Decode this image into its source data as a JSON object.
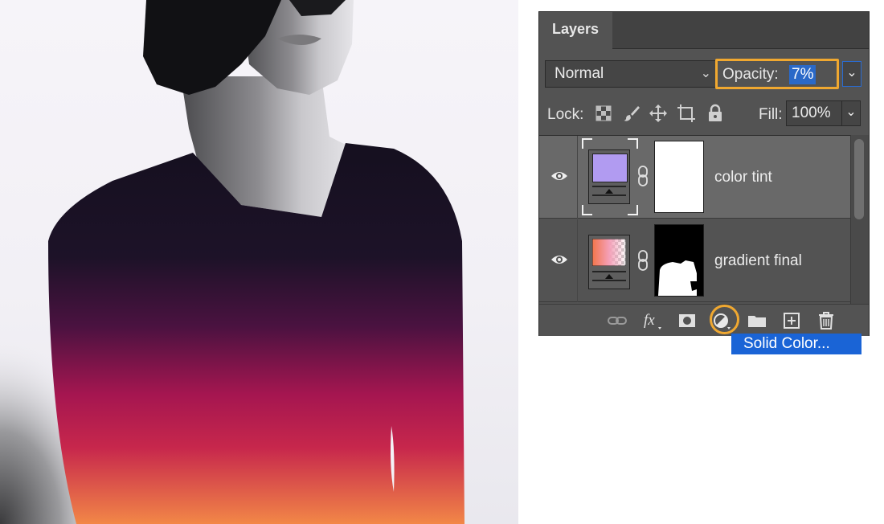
{
  "panel": {
    "tab_label": "Layers",
    "blend_mode": "Normal",
    "opacity_label": "Opacity:",
    "opacity_value": "7%",
    "lock_label": "Lock:",
    "fill_label": "Fill:",
    "fill_value": "100%"
  },
  "layers": [
    {
      "name": "color tint",
      "visible": true,
      "selected": true,
      "thumb_color": "#b19bf1",
      "mask": "white"
    },
    {
      "name": "gradient final",
      "visible": true,
      "selected": false,
      "thumb_gradient": [
        "#f2754a",
        "#f4a0b8"
      ],
      "mask": "silhouette"
    }
  ],
  "bottom_icons": [
    "link-icon",
    "fx-icon",
    "mask-icon",
    "adjustment-layer-icon",
    "folder-icon",
    "new-layer-icon",
    "trash-icon"
  ],
  "adjustment_menu": {
    "highlighted_item": "Solid Color..."
  },
  "colors": {
    "highlight_outline": "#f0a830",
    "selection_blue": "#1a64d6",
    "panel_bg": "#535353"
  }
}
